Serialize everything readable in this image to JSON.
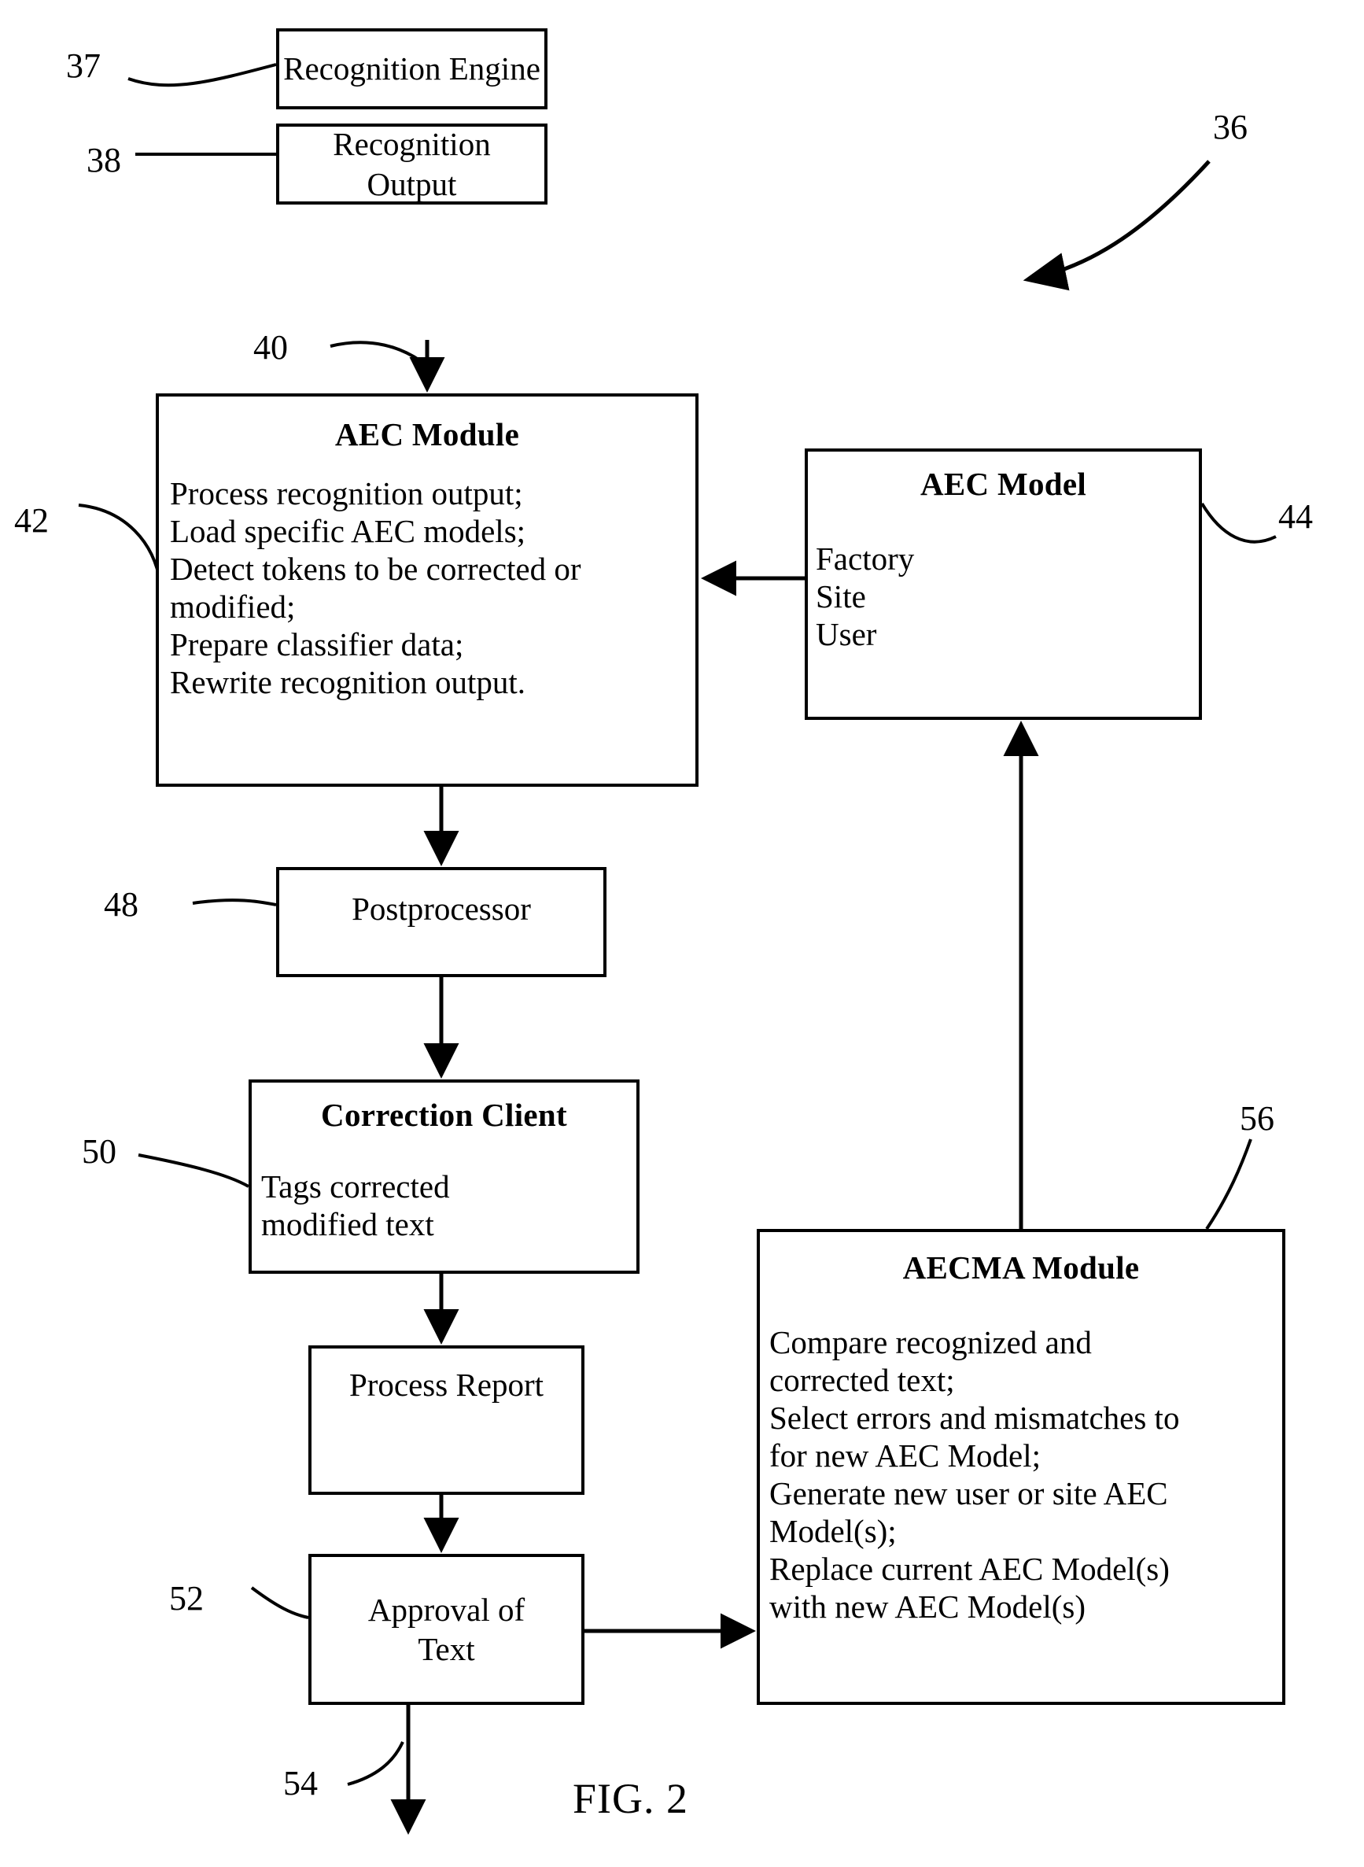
{
  "figure": {
    "label": "FIG. 2"
  },
  "boxes": {
    "recognition_engine": {
      "title": "Recognition\nEngine",
      "ref": "37"
    },
    "recognition_output": {
      "title": "Recognition\nOutput",
      "ref": "38"
    },
    "aec_module": {
      "title": "AEC Module",
      "body": "Process recognition output;\nLoad specific AEC models;\nDetect tokens to be corrected or\nmodified;\nPrepare classifier data;\nRewrite recognition output.",
      "ref_arrow": "40",
      "ref_body": "42"
    },
    "aec_model": {
      "title": "AEC Model",
      "body": "Factory\nSite\nUser",
      "ref": "44"
    },
    "postprocessor": {
      "title": "Postprocessor",
      "ref": "48"
    },
    "correction_client": {
      "title": "Correction Client",
      "body": "Tags corrected\nmodified text",
      "ref": "50"
    },
    "process_report": {
      "title": "Process Report"
    },
    "approval_of_text": {
      "title": "Approval of\nText",
      "ref": "52",
      "ref_output": "54"
    },
    "aecma_module": {
      "title": "AECMA Module",
      "body": "Compare recognized and\ncorrected text;\nSelect errors and mismatches to\nfor new AEC Model;\nGenerate new user or site AEC\nModel(s);\nReplace current AEC Model(s)\nwith new AEC Model(s)",
      "ref": "56"
    }
  },
  "system": {
    "ref": "36"
  },
  "colors": {
    "ink": "#000000",
    "paper": "#ffffff"
  }
}
